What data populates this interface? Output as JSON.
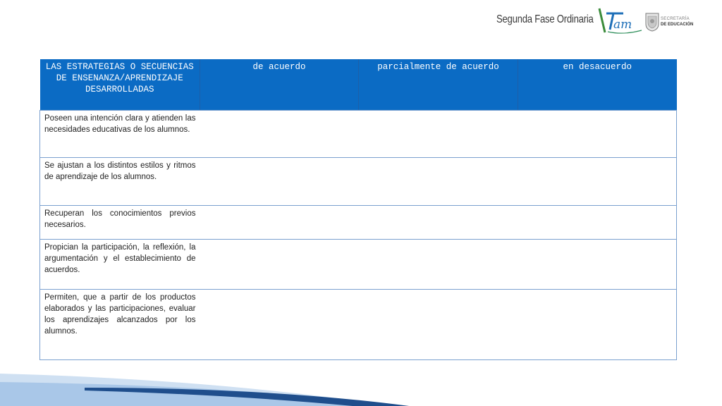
{
  "header": {
    "title": "Segunda Fase Ordinaria",
    "logo_tam": "Tam",
    "logo_line1": "SECRETARÍA",
    "logo_line2": "DE EDUCACIÓN"
  },
  "table": {
    "headers": [
      "LAS ESTRATEGIAS O SECUENCIAS DE ENSENANZA/APRENDIZAJE DESARROLLADAS",
      "de acuerdo",
      "parcialmente de acuerdo",
      "en desacuerdo"
    ],
    "rows": [
      "Poseen una intención clara y atienden las necesidades educativas de los alumnos.",
      "Se ajustan a los distintos estilos y ritmos de aprendizaje de los alumnos.",
      "Recuperan los conocimientos previos necesarios.",
      "Propician la participación, la reflexión, la argumentación y el establecimiento de acuerdos.",
      "Permiten, que a partir de los productos elaborados y las participaciones, evaluar los aprendizajes alcanzados por los alumnos."
    ]
  },
  "colors": {
    "header_bg": "#0b6bc4",
    "border": "#7aa0cf",
    "footer_light": "#cfe0f2",
    "footer_dark": "#1f4e8c"
  }
}
